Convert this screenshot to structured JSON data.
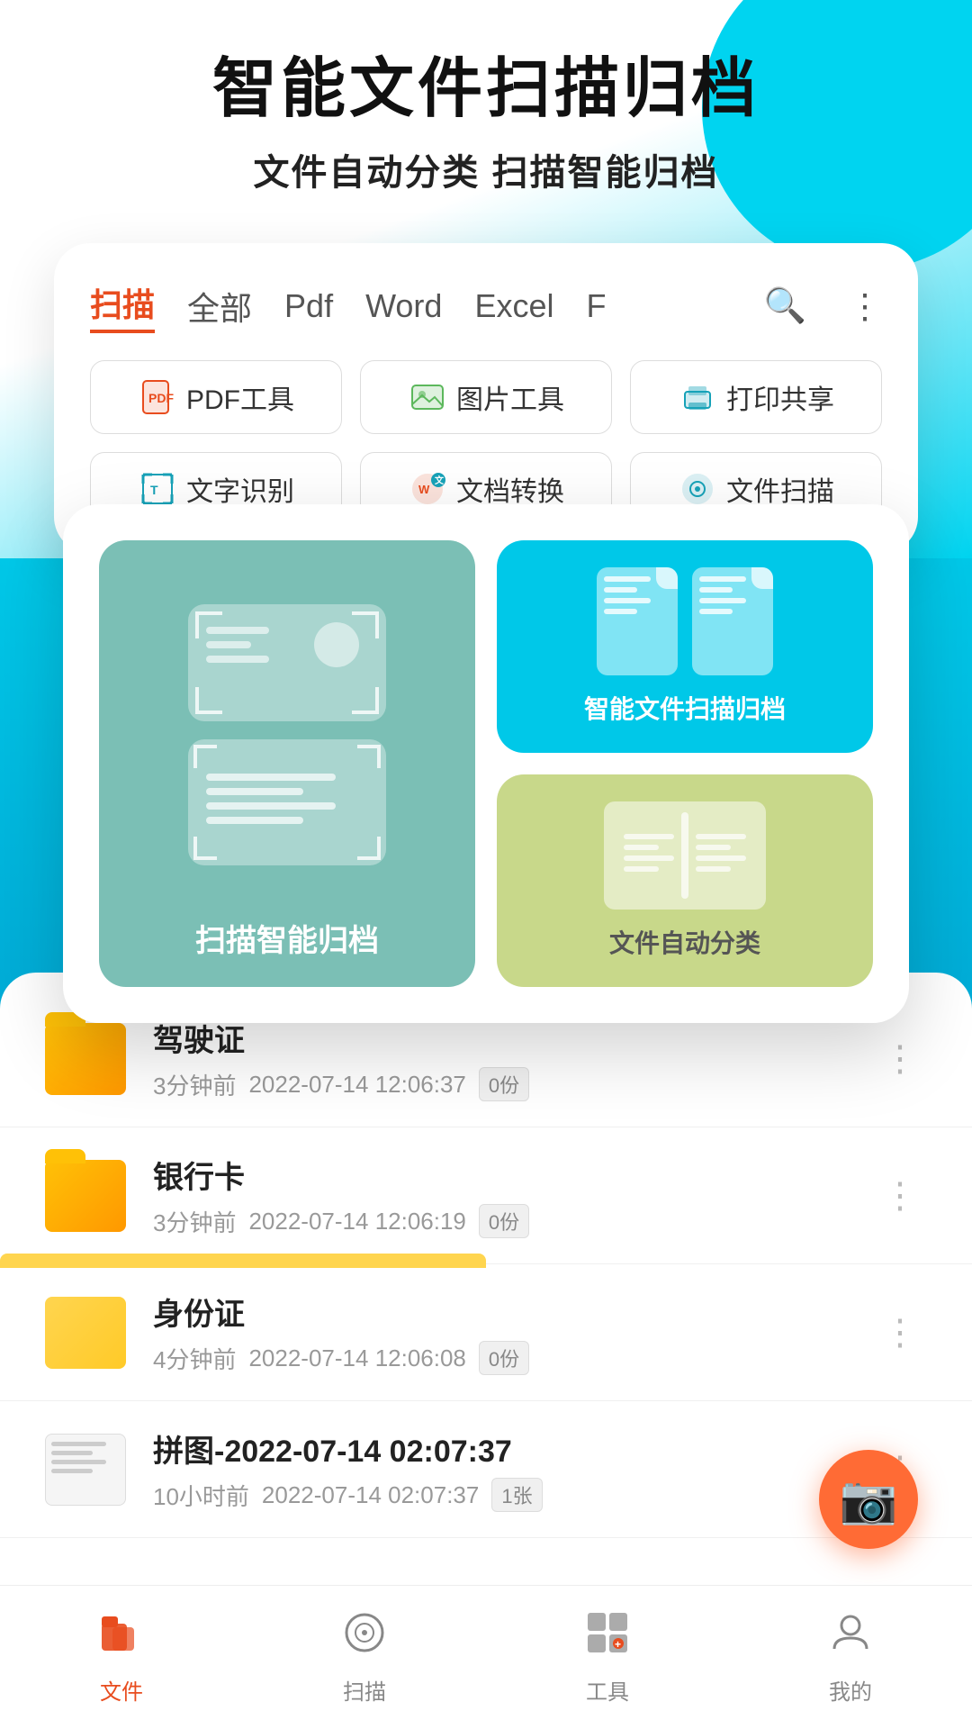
{
  "hero": {
    "title": "智能文件扫描归档",
    "subtitle": "文件自动分类   扫描智能归档"
  },
  "tabs": {
    "items": [
      {
        "label": "扫描",
        "active": true
      },
      {
        "label": "全部",
        "active": false
      },
      {
        "label": "Pdf",
        "active": false
      },
      {
        "label": "Word",
        "active": false
      },
      {
        "label": "Excel",
        "active": false
      },
      {
        "label": "F",
        "active": false
      }
    ]
  },
  "tools": [
    {
      "icon": "📄",
      "label": "PDF工具"
    },
    {
      "icon": "🖼️",
      "label": "图片工具"
    },
    {
      "icon": "🖨️",
      "label": "打印共享"
    }
  ],
  "features": [
    {
      "icon": "T",
      "label": "文字识别"
    },
    {
      "icon": "W",
      "label": "文档转换"
    },
    {
      "icon": "📷",
      "label": "文件扫描"
    }
  ],
  "popup": {
    "left_label": "扫描智能归档",
    "top_right_label": "智能文件扫描归档",
    "bottom_right_label": "文件自动分类"
  },
  "files": [
    {
      "name": "驾驶证",
      "time_ago": "3分钟前",
      "date": "2022-07-14 12:06:37",
      "count": "0份",
      "type": "folder"
    },
    {
      "name": "银行卡",
      "time_ago": "3分钟前",
      "date": "2022-07-14 12:06:19",
      "count": "0份",
      "type": "folder"
    },
    {
      "name": "身份证",
      "time_ago": "4分钟前",
      "date": "2022-07-14 12:06:08",
      "count": "0份",
      "type": "folder"
    },
    {
      "name": "拼图-2022-07-14 02:07:37",
      "time_ago": "10小时前",
      "date": "2022-07-14 02:07:37",
      "count": "1张",
      "type": "doc"
    }
  ],
  "bottom_nav": [
    {
      "label": "文件",
      "active": true
    },
    {
      "label": "扫描",
      "active": false
    },
    {
      "label": "工具",
      "active": false
    },
    {
      "label": "我的",
      "active": false
    }
  ]
}
